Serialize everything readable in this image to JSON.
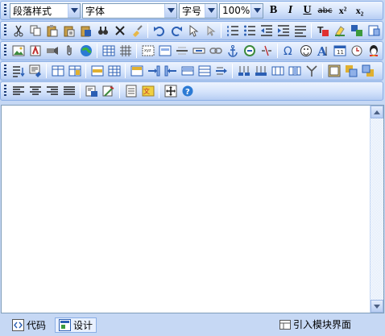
{
  "toolbar1": {
    "paragraph_style": "段落样式",
    "font_name": "字体",
    "font_size": "字号",
    "zoom": "100%",
    "buttons": [
      "bold",
      "italic",
      "underline",
      "strikethrough",
      "superscript",
      "subscript"
    ],
    "bold_label": "B",
    "italic_label": "I",
    "underline_label": "U",
    "strike_label": "abc",
    "superscript_label": "x²",
    "subscript_label": "x₂"
  },
  "status": {
    "code_label": "代码",
    "design_label": "设计",
    "module_label": "引入模块界面"
  },
  "colors": {
    "accent": "#c6d8f4",
    "toolbar_border": "#8aaee6",
    "scroll_track": "#d9e6f8"
  }
}
